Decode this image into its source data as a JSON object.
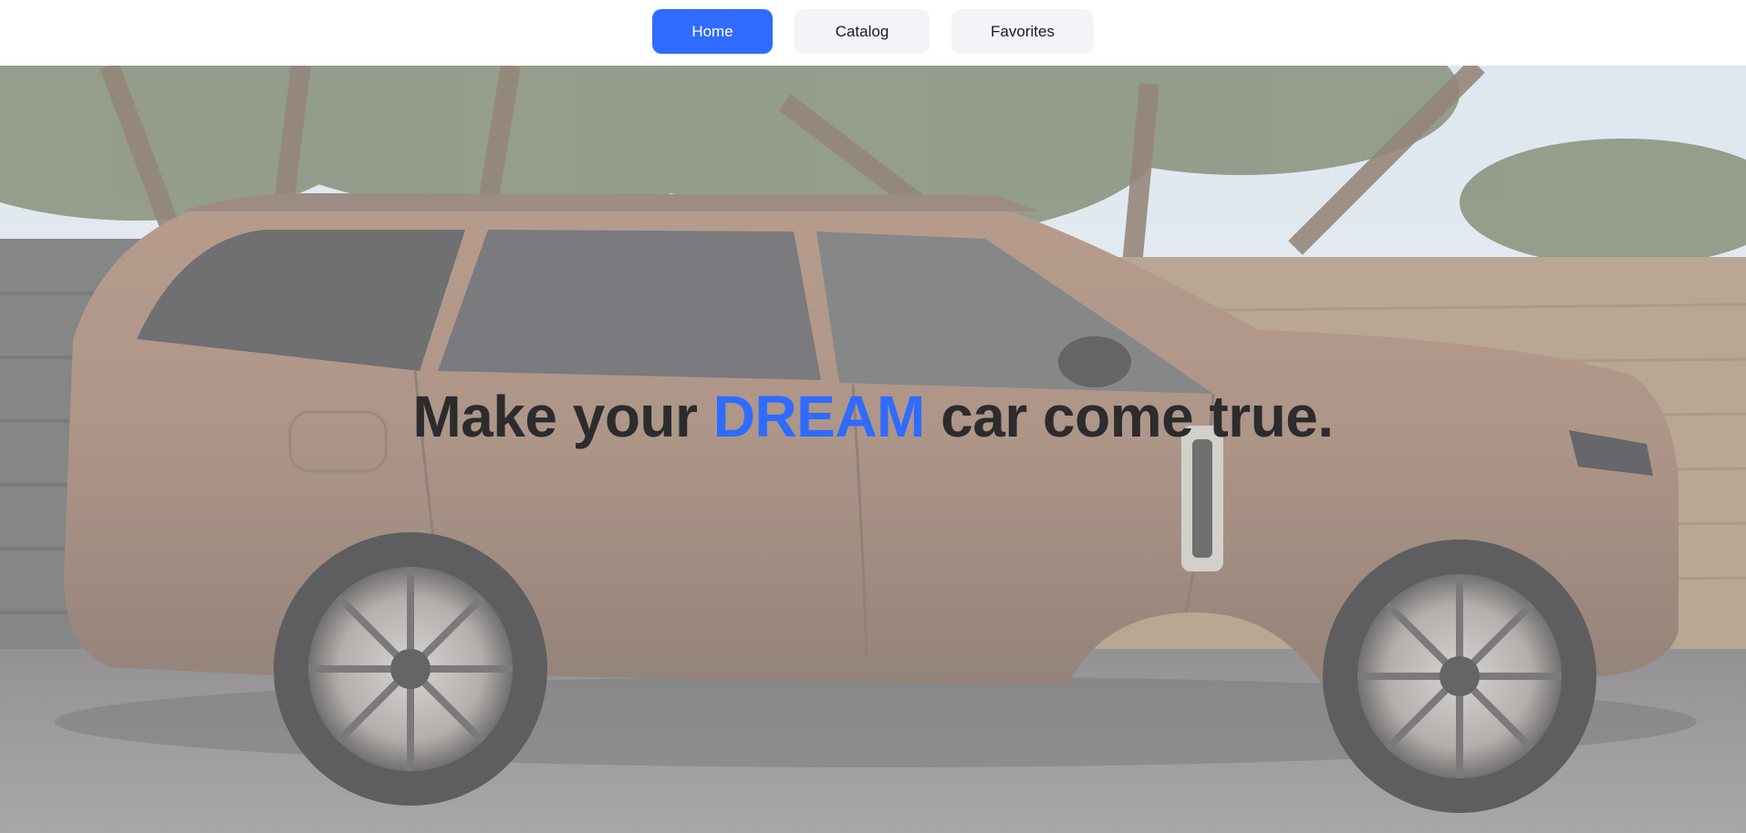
{
  "nav": {
    "items": [
      {
        "label": "Home",
        "active": true
      },
      {
        "label": "Catalog",
        "active": false
      },
      {
        "label": "Favorites",
        "active": false
      }
    ]
  },
  "hero": {
    "headline_before": "Make your ",
    "headline_highlight": "DREAM",
    "headline_after": " car come true.",
    "highlight_color": "#2f6bff"
  },
  "colors": {
    "accent": "#2f6bff",
    "nav_inactive_bg": "#f4f4f8",
    "headline_text": "#2c2b2d"
  }
}
